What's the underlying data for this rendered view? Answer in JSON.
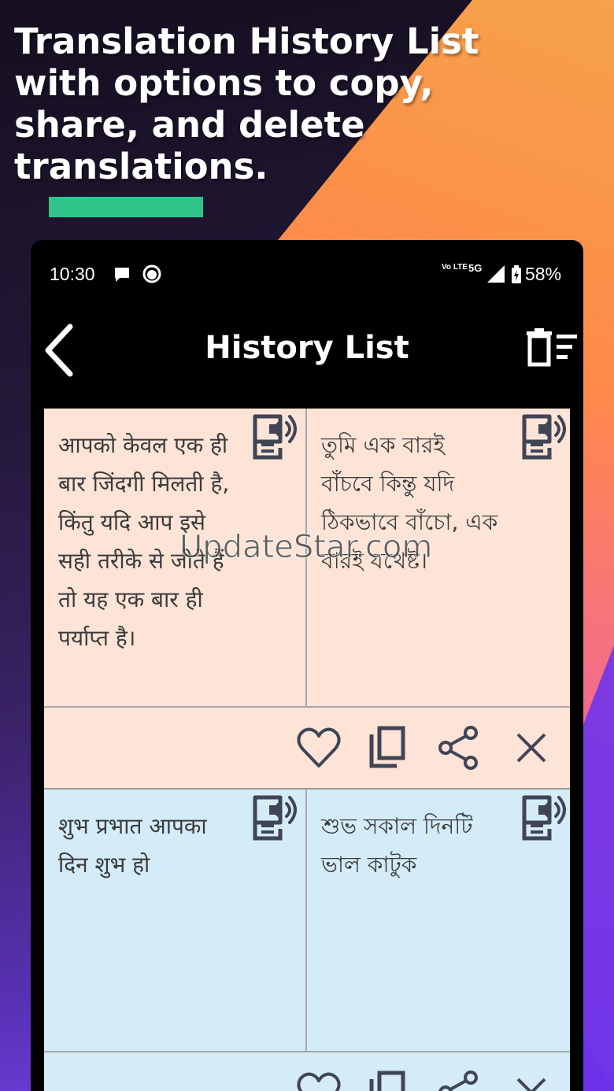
{
  "headline": "Translation History List with options to copy, share, and delete translations.",
  "status_bar": {
    "time": "10:30",
    "network_volte": "Vo LTE",
    "network_5g": "5G",
    "battery": "58%"
  },
  "app_bar": {
    "title": "History List",
    "back_icon": "arrow-back-icon",
    "clear_all_icon": "clear-history-icon"
  },
  "history_items": [
    {
      "source_text": "आपको केवल एक ही बार जिंदगी मिलती है, किंतु यदि आप इसे सही तरीके से जीते हैं तो यह एक बार ही पर्याप्त है।",
      "translated_text": "তুমি এক বারই বাঁচবে কিন্তু যদি ঠিকভাবে বাঁচো, এক বারই যথেষ্ট।",
      "color": "#fde4d7"
    },
    {
      "source_text": "शुभ प्रभात आपका दिन शुभ हो",
      "translated_text": "শুভ সকাল দিনটি ভাল কাটুক",
      "color": "#d3ecf8"
    }
  ],
  "actions": {
    "favorite_icon": "heart-outline-icon",
    "copy_icon": "copy-icon",
    "share_icon": "share-icon",
    "delete_icon": "close-icon",
    "speak_icon": "text-to-speech-icon"
  },
  "watermark": "UpdateStar.com",
  "colors": {
    "accent_bar": "#2fc48a",
    "icon_color": "#404556"
  }
}
